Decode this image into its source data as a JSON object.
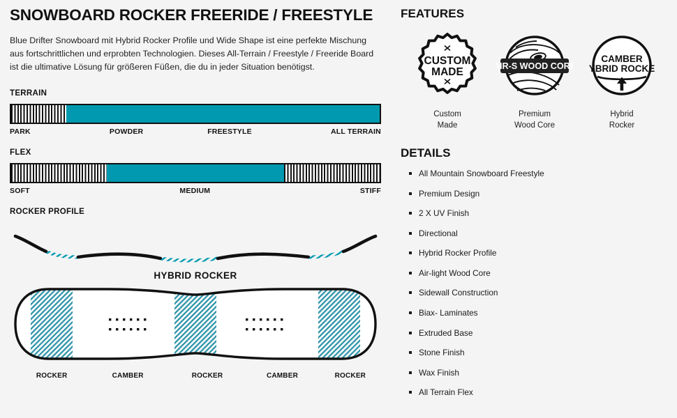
{
  "product": {
    "headline": "SNOWBOARD ROCKER FREERIDE / FREESTYLE",
    "description": "Blue Drifter Snowboard mit Hybrid Rocker Profile und Wide Shape ist eine perfekte Mischung aus fortschrittlichen und erprobten Technologien. Dieses All-Terrain / Freestyle / Freeride Board ist die ultimative Lösung für größeren Füßen, die du in jeder Situation benötigst."
  },
  "theme": {
    "accent": "#0099af",
    "ink": "#111111",
    "background": "#f4f4f4"
  },
  "terrain": {
    "label": "TERRAIN",
    "scale": [
      "PARK",
      "POWDER",
      "FREESTYLE",
      "ALL TERRAIN"
    ],
    "fill_start_pct": 15,
    "fill_end_pct": 100
  },
  "flex": {
    "label": "FLEX",
    "scale": [
      "SOFT",
      "MEDIUM",
      "STIFF"
    ],
    "fill_start_pct": 26,
    "fill_end_pct": 74
  },
  "rocker_profile": {
    "label": "ROCKER PROFILE",
    "title": "HYBRID ROCKER"
  },
  "board": {
    "zones": [
      {
        "label": "ROCKER",
        "center_pct": 9.5,
        "type": "rocker"
      },
      {
        "label": "CAMBER",
        "center_pct": 29.5,
        "type": "camber"
      },
      {
        "label": "ROCKER",
        "center_pct": 50.0,
        "type": "rocker"
      },
      {
        "label": "CAMBER",
        "center_pct": 70.5,
        "type": "camber"
      },
      {
        "label": "ROCKER",
        "center_pct": 90.5,
        "type": "rocker"
      }
    ],
    "insert_rows": 2,
    "insert_dots_per_row": 6
  },
  "features": {
    "title": "FEATURES",
    "items": [
      {
        "icon": "custom-made-seal-icon",
        "badge_lines": [
          "CUSTOM",
          "MADE"
        ],
        "caption_lines": [
          "Custom",
          "Made"
        ]
      },
      {
        "icon": "wood-core-circle-icon",
        "badge_lines": [
          "AIR-S WOOD CORE"
        ],
        "caption_lines": [
          "Premium",
          "Wood Core"
        ]
      },
      {
        "icon": "camber-hybrid-rocker-circle-icon",
        "badge_lines": [
          "CAMBER",
          "HYBRID ROCKER"
        ],
        "caption_lines": [
          "Hybrid",
          "Rocker"
        ]
      }
    ]
  },
  "details": {
    "title": "DETAILS",
    "items": [
      "All Mountain Snowboard Freestyle",
      "Premium Design",
      "2 X UV Finish",
      "Directional",
      "Hybrid Rocker Profile",
      "Air-light Wood Core",
      "Sidewall Construction",
      "Biax- Laminates",
      "Extruded Base",
      "Stone Finish",
      "Wax Finish",
      "All Terrain Flex"
    ]
  }
}
